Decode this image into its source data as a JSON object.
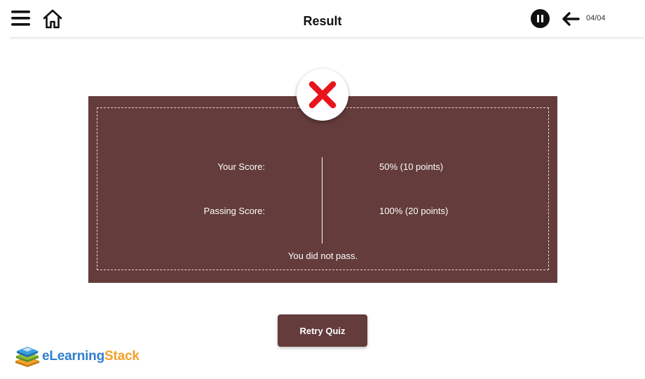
{
  "header": {
    "title": "Result",
    "page_counter": "04/04",
    "icons": {
      "menu": "hamburger-menu-icon",
      "home": "home-icon",
      "pause": "pause-icon",
      "back": "arrow-left-icon"
    }
  },
  "result": {
    "status_icon": "red-x-icon",
    "your_score_label": "Your Score:",
    "your_score_value": "50% (10 points)",
    "passing_score_label": "Passing Score:",
    "passing_score_value": "100% (20 points)",
    "message": "You did not pass."
  },
  "actions": {
    "retry_label": "Retry Quiz"
  },
  "branding": {
    "logo_prefix": "eLearning",
    "logo_suffix": "Stack"
  },
  "colors": {
    "panel": "#633c3b",
    "fail_red": "#e8141b",
    "logo_blue": "#2f7fd0",
    "logo_orange": "#f2a12b"
  }
}
